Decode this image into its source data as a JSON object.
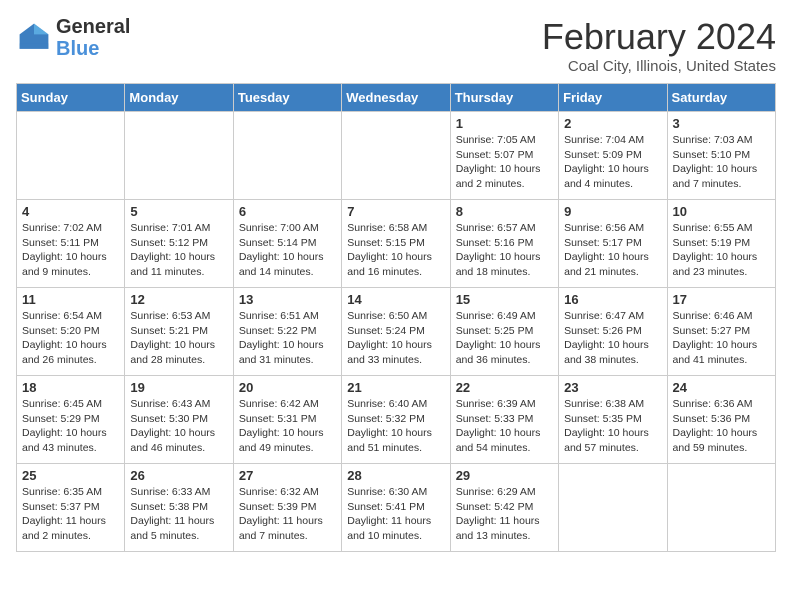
{
  "header": {
    "logo_line1": "General",
    "logo_line2": "Blue",
    "month_title": "February 2024",
    "location": "Coal City, Illinois, United States"
  },
  "weekdays": [
    "Sunday",
    "Monday",
    "Tuesday",
    "Wednesday",
    "Thursday",
    "Friday",
    "Saturday"
  ],
  "weeks": [
    [
      {
        "day": "",
        "info": ""
      },
      {
        "day": "",
        "info": ""
      },
      {
        "day": "",
        "info": ""
      },
      {
        "day": "",
        "info": ""
      },
      {
        "day": "1",
        "info": "Sunrise: 7:05 AM\nSunset: 5:07 PM\nDaylight: 10 hours\nand 2 minutes."
      },
      {
        "day": "2",
        "info": "Sunrise: 7:04 AM\nSunset: 5:09 PM\nDaylight: 10 hours\nand 4 minutes."
      },
      {
        "day": "3",
        "info": "Sunrise: 7:03 AM\nSunset: 5:10 PM\nDaylight: 10 hours\nand 7 minutes."
      }
    ],
    [
      {
        "day": "4",
        "info": "Sunrise: 7:02 AM\nSunset: 5:11 PM\nDaylight: 10 hours\nand 9 minutes."
      },
      {
        "day": "5",
        "info": "Sunrise: 7:01 AM\nSunset: 5:12 PM\nDaylight: 10 hours\nand 11 minutes."
      },
      {
        "day": "6",
        "info": "Sunrise: 7:00 AM\nSunset: 5:14 PM\nDaylight: 10 hours\nand 14 minutes."
      },
      {
        "day": "7",
        "info": "Sunrise: 6:58 AM\nSunset: 5:15 PM\nDaylight: 10 hours\nand 16 minutes."
      },
      {
        "day": "8",
        "info": "Sunrise: 6:57 AM\nSunset: 5:16 PM\nDaylight: 10 hours\nand 18 minutes."
      },
      {
        "day": "9",
        "info": "Sunrise: 6:56 AM\nSunset: 5:17 PM\nDaylight: 10 hours\nand 21 minutes."
      },
      {
        "day": "10",
        "info": "Sunrise: 6:55 AM\nSunset: 5:19 PM\nDaylight: 10 hours\nand 23 minutes."
      }
    ],
    [
      {
        "day": "11",
        "info": "Sunrise: 6:54 AM\nSunset: 5:20 PM\nDaylight: 10 hours\nand 26 minutes."
      },
      {
        "day": "12",
        "info": "Sunrise: 6:53 AM\nSunset: 5:21 PM\nDaylight: 10 hours\nand 28 minutes."
      },
      {
        "day": "13",
        "info": "Sunrise: 6:51 AM\nSunset: 5:22 PM\nDaylight: 10 hours\nand 31 minutes."
      },
      {
        "day": "14",
        "info": "Sunrise: 6:50 AM\nSunset: 5:24 PM\nDaylight: 10 hours\nand 33 minutes."
      },
      {
        "day": "15",
        "info": "Sunrise: 6:49 AM\nSunset: 5:25 PM\nDaylight: 10 hours\nand 36 minutes."
      },
      {
        "day": "16",
        "info": "Sunrise: 6:47 AM\nSunset: 5:26 PM\nDaylight: 10 hours\nand 38 minutes."
      },
      {
        "day": "17",
        "info": "Sunrise: 6:46 AM\nSunset: 5:27 PM\nDaylight: 10 hours\nand 41 minutes."
      }
    ],
    [
      {
        "day": "18",
        "info": "Sunrise: 6:45 AM\nSunset: 5:29 PM\nDaylight: 10 hours\nand 43 minutes."
      },
      {
        "day": "19",
        "info": "Sunrise: 6:43 AM\nSunset: 5:30 PM\nDaylight: 10 hours\nand 46 minutes."
      },
      {
        "day": "20",
        "info": "Sunrise: 6:42 AM\nSunset: 5:31 PM\nDaylight: 10 hours\nand 49 minutes."
      },
      {
        "day": "21",
        "info": "Sunrise: 6:40 AM\nSunset: 5:32 PM\nDaylight: 10 hours\nand 51 minutes."
      },
      {
        "day": "22",
        "info": "Sunrise: 6:39 AM\nSunset: 5:33 PM\nDaylight: 10 hours\nand 54 minutes."
      },
      {
        "day": "23",
        "info": "Sunrise: 6:38 AM\nSunset: 5:35 PM\nDaylight: 10 hours\nand 57 minutes."
      },
      {
        "day": "24",
        "info": "Sunrise: 6:36 AM\nSunset: 5:36 PM\nDaylight: 10 hours\nand 59 minutes."
      }
    ],
    [
      {
        "day": "25",
        "info": "Sunrise: 6:35 AM\nSunset: 5:37 PM\nDaylight: 11 hours\nand 2 minutes."
      },
      {
        "day": "26",
        "info": "Sunrise: 6:33 AM\nSunset: 5:38 PM\nDaylight: 11 hours\nand 5 minutes."
      },
      {
        "day": "27",
        "info": "Sunrise: 6:32 AM\nSunset: 5:39 PM\nDaylight: 11 hours\nand 7 minutes."
      },
      {
        "day": "28",
        "info": "Sunrise: 6:30 AM\nSunset: 5:41 PM\nDaylight: 11 hours\nand 10 minutes."
      },
      {
        "day": "29",
        "info": "Sunrise: 6:29 AM\nSunset: 5:42 PM\nDaylight: 11 hours\nand 13 minutes."
      },
      {
        "day": "",
        "info": ""
      },
      {
        "day": "",
        "info": ""
      }
    ]
  ]
}
